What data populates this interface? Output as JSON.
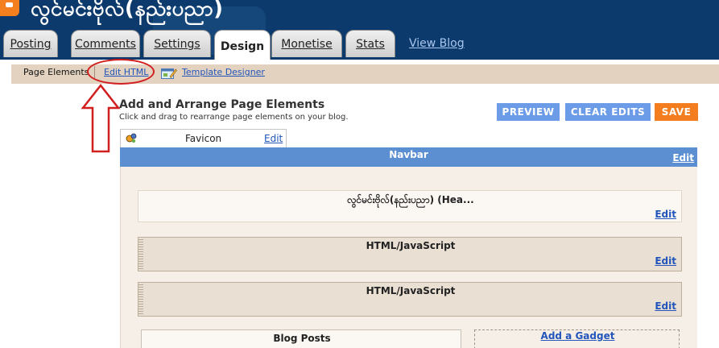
{
  "header": {
    "blog_title": "လွင်မင်းဗိုလ်(နည်းပညာ)",
    "tabs": [
      {
        "label": "Posting"
      },
      {
        "label": "Comments"
      },
      {
        "label": "Settings"
      },
      {
        "label": "Design",
        "active": true
      },
      {
        "label": "Monetise"
      },
      {
        "label": "Stats"
      }
    ],
    "view_blog_label": "View Blog"
  },
  "subnav": {
    "page_elements_label": "Page Elements",
    "edit_html_label": "Edit HTML",
    "template_designer_label": "Template Designer"
  },
  "main": {
    "title": "Add and Arrange Page Elements",
    "subtitle": "Click and drag to rearrange page elements on your blog.",
    "buttons": {
      "preview": "PREVIEW",
      "clear_edits": "CLEAR EDITS",
      "save": "SAVE"
    },
    "favicon": {
      "label": "Favicon",
      "edit": "Edit"
    },
    "navbar": {
      "label": "Navbar",
      "edit": "Edit"
    },
    "widgets": [
      {
        "label": "လွင်မင်းဗိုလ်(နည်းပညာ) (Hea...",
        "edit": "Edit"
      },
      {
        "label": "HTML/JavaScript",
        "edit": "Edit"
      },
      {
        "label": "HTML/JavaScript",
        "edit": "Edit"
      }
    ],
    "blog_posts_label": "Blog Posts",
    "add_gadget_label": "Add a Gadget"
  },
  "colors": {
    "header_bg": "#0c3a6c",
    "accent_blue": "#6c9be7",
    "save_orange": "#f47e1f",
    "navbar_blue": "#5b8fd2",
    "annotation_red": "#d11e1e"
  }
}
